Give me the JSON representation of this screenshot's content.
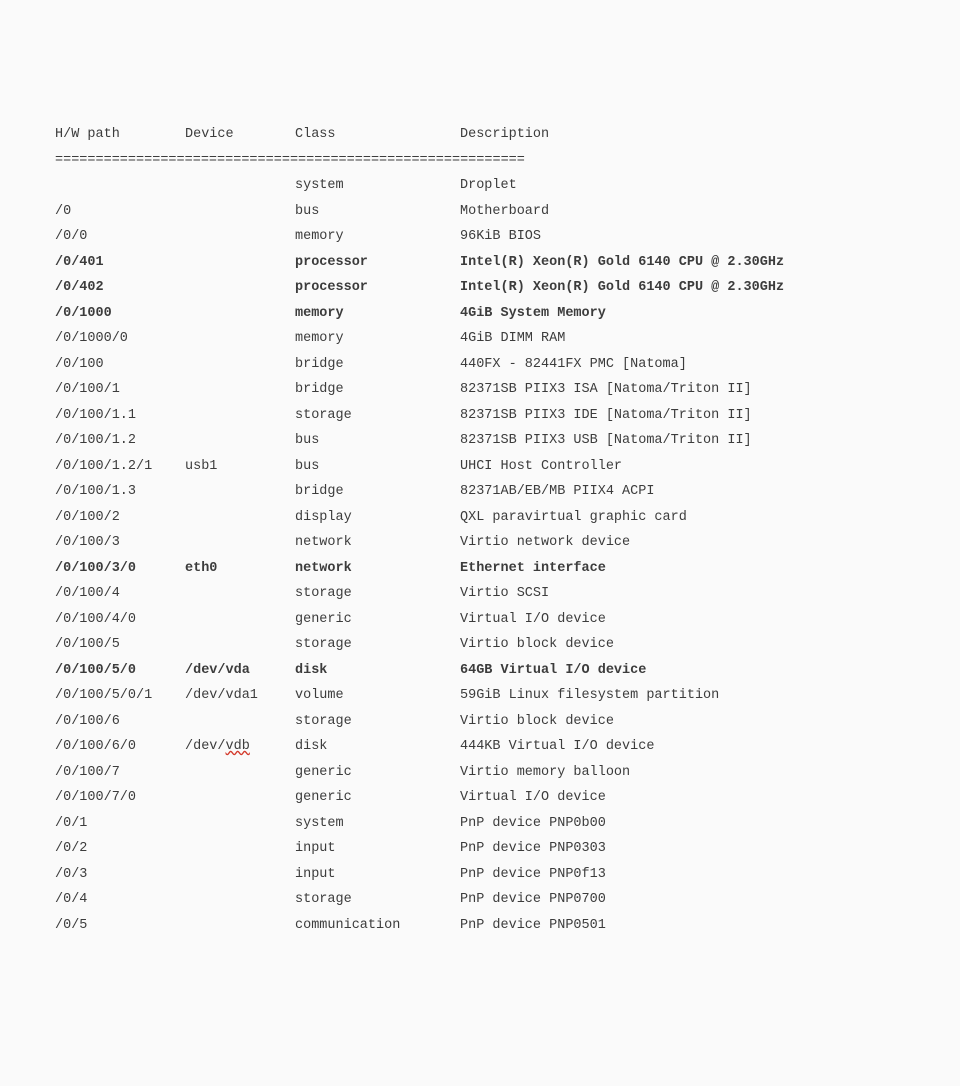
{
  "header": {
    "path": "H/W path",
    "device": "Device",
    "class": "Class",
    "desc": "Description"
  },
  "separator": "==========================================================",
  "rows": [
    {
      "path": "",
      "device": "",
      "class": "system",
      "desc": "Droplet",
      "bold": false,
      "squiggle": false
    },
    {
      "path": "/0",
      "device": "",
      "class": "bus",
      "desc": "Motherboard",
      "bold": false,
      "squiggle": false
    },
    {
      "path": "/0/0",
      "device": "",
      "class": "memory",
      "desc": "96KiB BIOS",
      "bold": false,
      "squiggle": false
    },
    {
      "path": "/0/401",
      "device": "",
      "class": "processor",
      "desc": "Intel(R) Xeon(R) Gold 6140 CPU @ 2.30GHz",
      "bold": true,
      "squiggle": false
    },
    {
      "path": "/0/402",
      "device": "",
      "class": "processor",
      "desc": "Intel(R) Xeon(R) Gold 6140 CPU @ 2.30GHz",
      "bold": true,
      "squiggle": false
    },
    {
      "path": "/0/1000",
      "device": "",
      "class": "memory",
      "desc": "4GiB System Memory",
      "bold": true,
      "squiggle": false
    },
    {
      "path": "/0/1000/0",
      "device": "",
      "class": "memory",
      "desc": "4GiB DIMM RAM",
      "bold": false,
      "squiggle": false
    },
    {
      "path": "/0/100",
      "device": "",
      "class": "bridge",
      "desc": "440FX - 82441FX PMC [Natoma]",
      "bold": false,
      "squiggle": false
    },
    {
      "path": "/0/100/1",
      "device": "",
      "class": "bridge",
      "desc": "82371SB PIIX3 ISA [Natoma/Triton II]",
      "bold": false,
      "squiggle": false
    },
    {
      "path": "/0/100/1.1",
      "device": "",
      "class": "storage",
      "desc": "82371SB PIIX3 IDE [Natoma/Triton II]",
      "bold": false,
      "squiggle": false
    },
    {
      "path": "/0/100/1.2",
      "device": "",
      "class": "bus",
      "desc": "82371SB PIIX3 USB [Natoma/Triton II]",
      "bold": false,
      "squiggle": false
    },
    {
      "path": "/0/100/1.2/1",
      "device": "usb1",
      "class": "bus",
      "desc": "UHCI Host Controller",
      "bold": false,
      "squiggle": false
    },
    {
      "path": "/0/100/1.3",
      "device": "",
      "class": "bridge",
      "desc": "82371AB/EB/MB PIIX4 ACPI",
      "bold": false,
      "squiggle": false
    },
    {
      "path": "/0/100/2",
      "device": "",
      "class": "display",
      "desc": "QXL paravirtual graphic card",
      "bold": false,
      "squiggle": false
    },
    {
      "path": "/0/100/3",
      "device": "",
      "class": "network",
      "desc": "Virtio network device",
      "bold": false,
      "squiggle": false
    },
    {
      "path": "/0/100/3/0",
      "device": "eth0",
      "class": "network",
      "desc": "Ethernet interface",
      "bold": true,
      "squiggle": false
    },
    {
      "path": "/0/100/4",
      "device": "",
      "class": "storage",
      "desc": "Virtio SCSI",
      "bold": false,
      "squiggle": false
    },
    {
      "path": "/0/100/4/0",
      "device": "",
      "class": "generic",
      "desc": "Virtual I/O device",
      "bold": false,
      "squiggle": false
    },
    {
      "path": "/0/100/5",
      "device": "",
      "class": "storage",
      "desc": "Virtio block device",
      "bold": false,
      "squiggle": false
    },
    {
      "path": "/0/100/5/0",
      "device": "/dev/vda",
      "class": "disk",
      "desc": "64GB Virtual I/O device",
      "bold": true,
      "squiggle": false
    },
    {
      "path": "/0/100/5/0/1",
      "device": "/dev/vda1",
      "class": "volume",
      "desc": "59GiB Linux filesystem partition",
      "bold": false,
      "squiggle": false
    },
    {
      "path": "/0/100/6",
      "device": "",
      "class": "storage",
      "desc": "Virtio block device",
      "bold": false,
      "squiggle": false
    },
    {
      "path": "/0/100/6/0",
      "device": "/dev/vdb",
      "class": "disk",
      "desc": "444KB Virtual I/O device",
      "bold": false,
      "squiggle": true
    },
    {
      "path": "/0/100/7",
      "device": "",
      "class": "generic",
      "desc": "Virtio memory balloon",
      "bold": false,
      "squiggle": false
    },
    {
      "path": "/0/100/7/0",
      "device": "",
      "class": "generic",
      "desc": "Virtual I/O device",
      "bold": false,
      "squiggle": false
    },
    {
      "path": "/0/1",
      "device": "",
      "class": "system",
      "desc": "PnP device PNP0b00",
      "bold": false,
      "squiggle": false
    },
    {
      "path": "/0/2",
      "device": "",
      "class": "input",
      "desc": "PnP device PNP0303",
      "bold": false,
      "squiggle": false
    },
    {
      "path": "/0/3",
      "device": "",
      "class": "input",
      "desc": "PnP device PNP0f13",
      "bold": false,
      "squiggle": false
    },
    {
      "path": "/0/4",
      "device": "",
      "class": "storage",
      "desc": "PnP device PNP0700",
      "bold": false,
      "squiggle": false
    },
    {
      "path": "/0/5",
      "device": "",
      "class": "communication",
      "desc": "PnP device PNP0501",
      "bold": false,
      "squiggle": false
    }
  ]
}
